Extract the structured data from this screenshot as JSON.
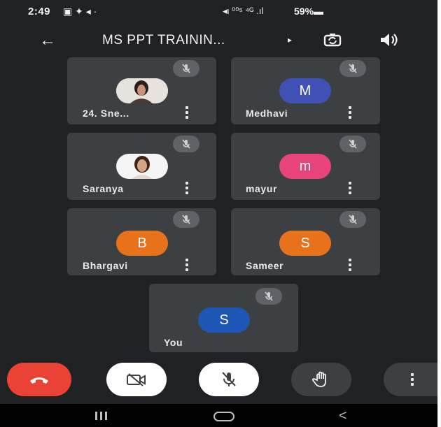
{
  "status_bar": {
    "time": "2:49",
    "left_icons": "▣ ✦ ◂ ·",
    "right_icons": "◂ι ⁰⁰⁵ ⁴ᴳ .ıl",
    "battery": "59%▬"
  },
  "header": {
    "title": "MS PPT TRAININ...",
    "back_icon": "arrow-left-icon",
    "switch_camera_icon": "camera-switch-icon",
    "speaker_icon": "speaker-icon"
  },
  "participants": [
    {
      "name": "24. Sne...",
      "avatar_type": "photo",
      "muted": true
    },
    {
      "name": "Medhavi",
      "initial": "M",
      "avatar_color": "#3f51b5",
      "muted": true
    },
    {
      "name": "Saranya",
      "avatar_type": "photo",
      "muted": true
    },
    {
      "name": "mayur",
      "initial": "m",
      "avatar_color": "#e8437b",
      "muted": true
    },
    {
      "name": "Bhargavi",
      "initial": "B",
      "avatar_color": "#e8711c",
      "muted": true
    },
    {
      "name": "Sameer",
      "initial": "S",
      "avatar_color": "#e8711c",
      "muted": true
    },
    {
      "name": "You",
      "initial": "S",
      "avatar_color": "#1e56b5",
      "muted": true
    }
  ],
  "controls": {
    "end_call": {
      "icon": "phone-hangup-icon",
      "color": "#ea4335"
    },
    "camera": {
      "icon": "camera-off-icon",
      "color": "#ffffff"
    },
    "mic": {
      "icon": "mic-off-icon",
      "color": "#ffffff"
    },
    "raise_hand": {
      "icon": "hand-icon",
      "color": "#3c4043"
    },
    "more": {
      "icon": "more-vertical-icon",
      "color": "#3c4043"
    }
  },
  "nav": {
    "recents_icon": "recents-icon",
    "home_icon": "home-icon",
    "back_icon": "chevron-left-icon",
    "back_glyph": "<"
  }
}
